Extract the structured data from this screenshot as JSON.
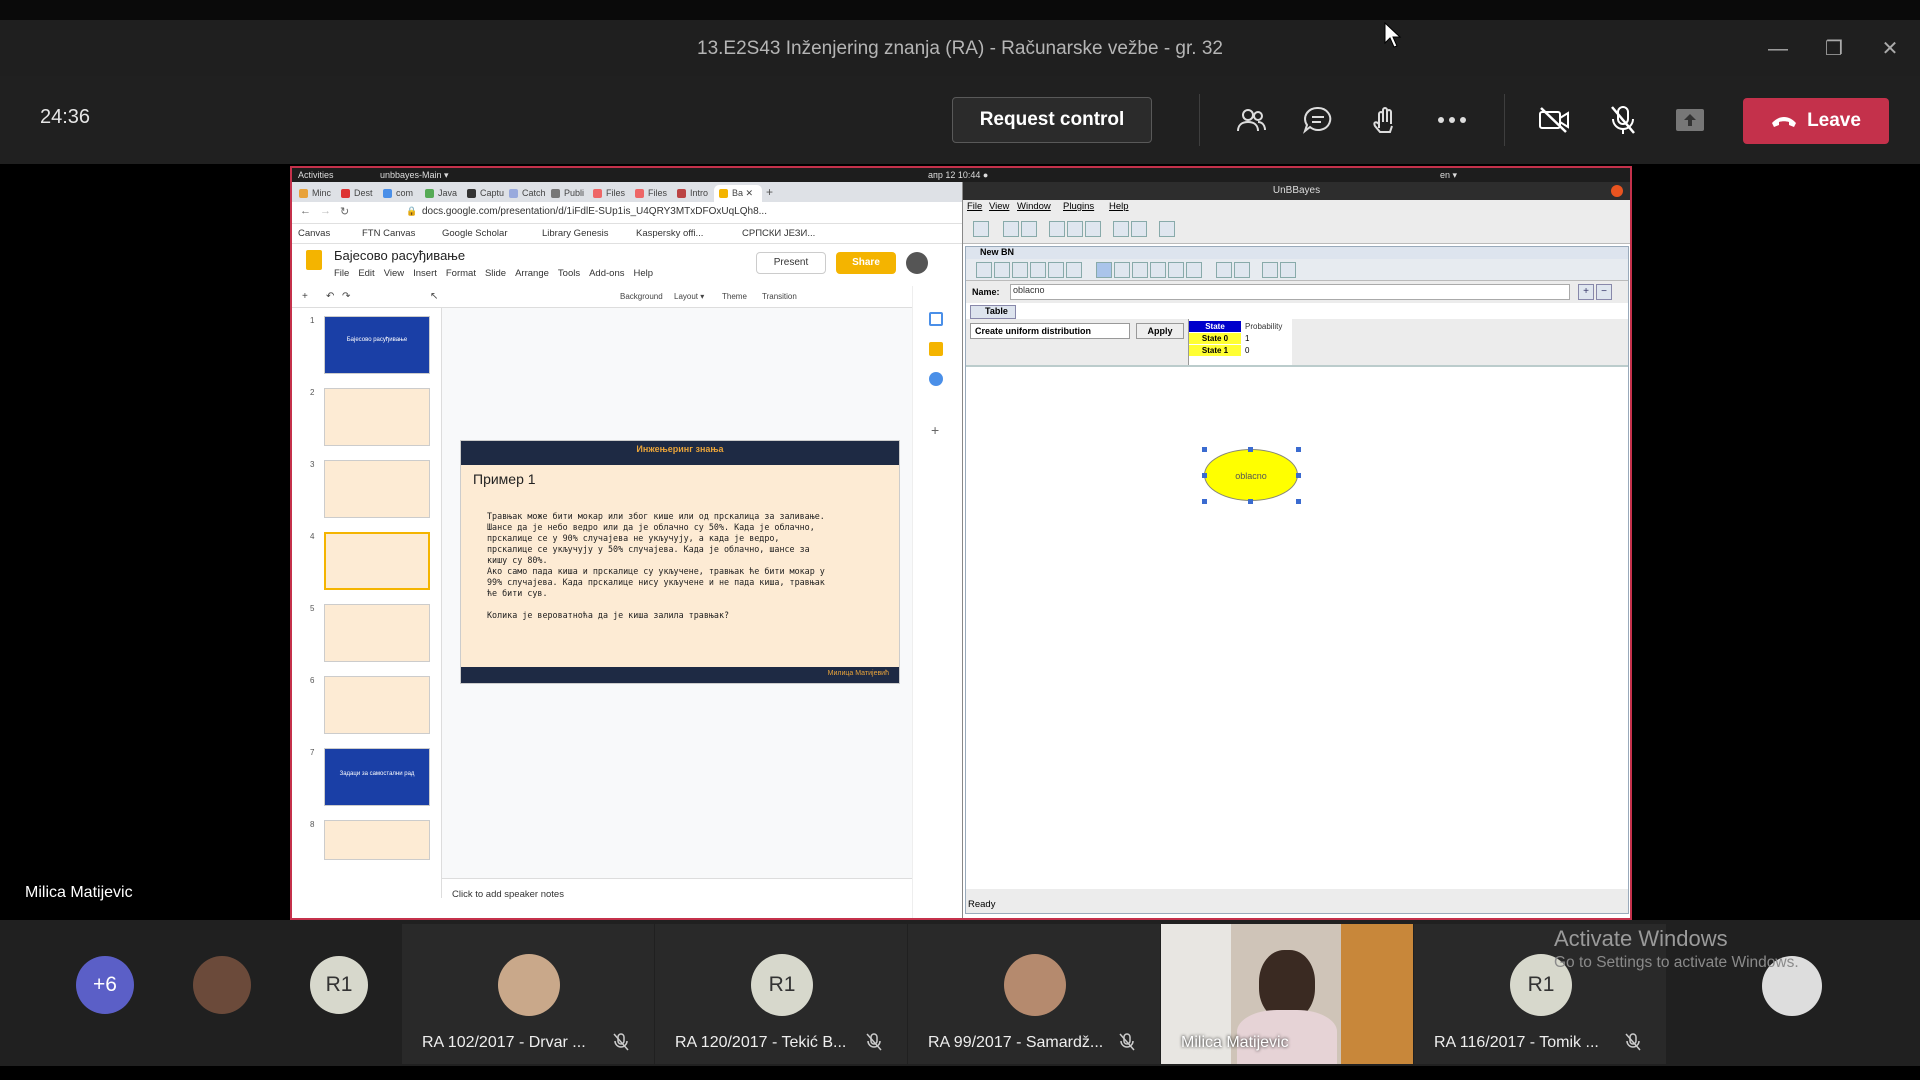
{
  "window": {
    "title": "13.E2S43 Inženjering znanja (RA) - Računarske vežbe - gr. 32"
  },
  "toolbar": {
    "timer": "24:36",
    "request_control_label": "Request control",
    "leave_label": "Leave",
    "leave_color": "#c4314b"
  },
  "presenter": {
    "name": "Milica Matijevic"
  },
  "ubuntu_bar": {
    "activities": "Activities",
    "app": "unbbayes-Main ▾",
    "clock": "апр 12  10:44  ●",
    "lang": "en ▾"
  },
  "browser": {
    "tabs": [
      "Minc",
      "Dest",
      "com",
      "Java",
      "Captu",
      "Catch",
      "Publi",
      "Files",
      "Files",
      "Intro",
      "Ba"
    ],
    "url": "docs.google.com/presentation/d/1iFdlE-SUp1is_U4QRY3MTxDFOxUqLQh8...",
    "bookmarks": [
      "Canvas",
      "FTN Canvas",
      "Google Scholar",
      "Library Genesis",
      "Kaspersky offi...",
      "СРПСКИ ЈЕЗИ..."
    ]
  },
  "slides": {
    "doc_title": "Бајесово расуђивање",
    "menu": [
      "File",
      "Edit",
      "View",
      "Insert",
      "Format",
      "Slide",
      "Arrange",
      "Tools",
      "Add-ons",
      "Help"
    ],
    "present_label": "Present",
    "share_label": "Share",
    "toolbar_items": [
      "Background",
      "Layout ▾",
      "Theme",
      "Transition"
    ],
    "thumb_numbers": [
      "1",
      "2",
      "3",
      "4",
      "5",
      "6",
      "7",
      "8"
    ],
    "thumb1_text": "Бајесово расуђивање",
    "thumb7_text": "Задаци за самостални рад",
    "slide_header": "Инжењеринг знања",
    "slide_title": "Пример 1",
    "slide_body": [
      "Травњак може бити мокар или због кише или од прскалица за заливање.",
      "Шансе да је небо ведро или да је облачно су 50%. Када је облачно,",
      "прскалице се у 90% случајева не укључују, а када је ведро,",
      "прскалице се укључују у 50% случајева. Када је облачно, шансе за",
      "кишу су 80%.",
      "Ако само пада киша и прскалице су укључене, травњак ће бити мокар у",
      "99% случајева. Када прскалице нису укључене и не пада киша, травњак",
      "ће бити сув.",
      "",
      "Колика је вероватноћа да је киша залила травњак?"
    ],
    "slide_footer": "Милица Матијевић",
    "notes_placeholder": "Click to add speaker notes"
  },
  "unbbayes": {
    "title": "UnBBayes",
    "menu": [
      "File",
      "View",
      "Window",
      "Plugins",
      "Help"
    ],
    "inner_title": "New BN",
    "name_label": "Name:",
    "name_value": "oblacno",
    "table_tab": "Table",
    "dist_select": "Create uniform distribution",
    "apply_label": "Apply",
    "cpt_state_header": "State",
    "cpt_prob_header": "Probability",
    "cpt_rows": [
      {
        "state": "State 0",
        "prob": "1"
      },
      {
        "state": "State 1",
        "prob": "0"
      }
    ],
    "node_label": "oblacno",
    "status": "Ready"
  },
  "participants": {
    "overflow": "+6",
    "tiles": [
      {
        "initials": "R1",
        "name": "RA 102/2017 - Drvar ..."
      },
      {
        "initials": "R1",
        "name": "RA 120/2017 - Tekić B..."
      },
      {
        "initials": "",
        "name": "RA 99/2017 - Samardž..."
      },
      {
        "initials": "",
        "name": "Milica Matijevic"
      },
      {
        "initials": "R1",
        "name": "RA 116/2017 - Tomik ..."
      }
    ],
    "small_initials": "R1"
  },
  "watermark": {
    "line1": "Activate Windows",
    "line2": "Go to Settings to activate Windows."
  }
}
